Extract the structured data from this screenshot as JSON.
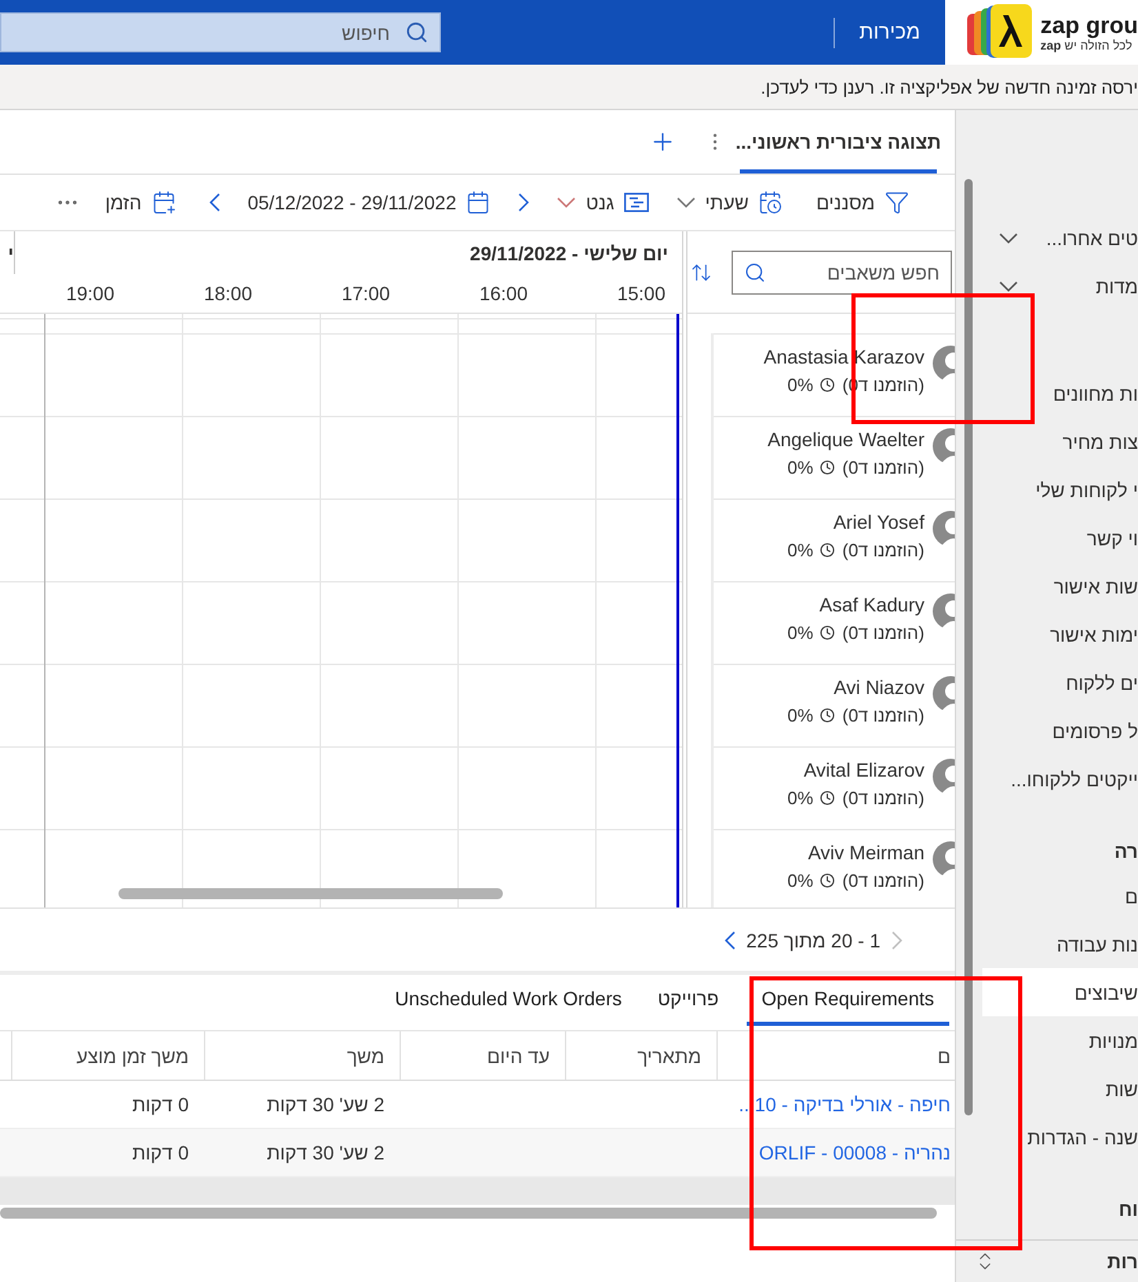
{
  "top_bar": {
    "logo_text": "zap grou",
    "logo_tagline": "לכל הזולה יש **zap**",
    "app_name": "מכירות",
    "search": {
      "placeholder": "חיפוש"
    }
  },
  "notification": "ירסה זמינה חדשה של אפליקציה זו. רענן כדי לעדכן.",
  "sidebar": {
    "items": [
      {
        "kind": "expander",
        "label": "טים אחרו...",
        "selected": false
      },
      {
        "kind": "expander",
        "label": "מדות",
        "selected": false
      },
      {
        "kind": "item",
        "label": "ות מחוונים",
        "selected": false
      },
      {
        "kind": "item",
        "label": "צות מחיר",
        "selected": false
      },
      {
        "kind": "item",
        "label": "י לקוחות שלי",
        "selected": false
      },
      {
        "kind": "item",
        "label": "וי קשר",
        "selected": false
      },
      {
        "kind": "item",
        "label": "שות אישור",
        "selected": false
      },
      {
        "kind": "item",
        "label": "ימות אישור",
        "selected": false
      },
      {
        "kind": "item",
        "label": "ים ללקוח",
        "selected": false
      },
      {
        "kind": "item",
        "label": "ל פרסומים",
        "selected": false
      },
      {
        "kind": "item",
        "label": "ייקטים ללקוחו...",
        "selected": false
      },
      {
        "kind": "group",
        "label": "רה",
        "selected": false
      },
      {
        "kind": "item",
        "label": "ם",
        "selected": false
      },
      {
        "kind": "item",
        "label": "נות עבודה",
        "selected": false
      },
      {
        "kind": "item",
        "label": "שיבוצים",
        "selected": true
      },
      {
        "kind": "item",
        "label": "מנויות",
        "selected": false
      },
      {
        "kind": "item",
        "label": "שות",
        "selected": false
      },
      {
        "kind": "item",
        "label": "שנה - הגדרות",
        "selected": false
      },
      {
        "kind": "group",
        "label": "וח",
        "selected": false
      }
    ],
    "area_switcher": {
      "label": "רות"
    }
  },
  "view_tabs": [
    {
      "label": "תצוגה ציבורית ראשוני...",
      "selected": true
    }
  ],
  "toolbar": {
    "filters": "מסננים",
    "resolution": "שעתי",
    "view": "גנט",
    "date_range": "29/11/2022 - 05/12/2022",
    "book": "הזמן"
  },
  "scheduler": {
    "resource_search": {
      "placeholder": "חפש משאבים"
    },
    "day_label": "יום שלישי - 29/11/2022",
    "next_day_label": "י",
    "hours": [
      "15:00",
      "16:00",
      "17:00",
      "18:00",
      "19:00"
    ],
    "resources": [
      {
        "name": "Anastasia Karazov",
        "booked": "(הוזמנו ד0)",
        "utilization": "0%"
      },
      {
        "name": "Angelique Waelter",
        "booked": "(הוזמנו ד0)",
        "utilization": "0%"
      },
      {
        "name": "Ariel Yosef",
        "booked": "(הוזמנו ד0)",
        "utilization": "0%"
      },
      {
        "name": "Asaf Kadury",
        "booked": "(הוזמנו ד0)",
        "utilization": "0%"
      },
      {
        "name": "Avi Niazov",
        "booked": "(הוזמנו ד0)",
        "utilization": "0%"
      },
      {
        "name": "Avital Elizarov",
        "booked": "(הוזמנו ד0)",
        "utilization": "0%"
      },
      {
        "name": "Aviv Meirman",
        "booked": "(הוזמנו ד0)",
        "utilization": "0%"
      }
    ]
  },
  "pagination": {
    "range": "1 - 20 מתוך 225",
    "previous_disabled": true,
    "next_disabled": false
  },
  "bottom_tabs": [
    {
      "label": "Open Requirements",
      "selected": true
    },
    {
      "label": "פרוייקט",
      "selected": false
    },
    {
      "label": "Unscheduled Work Orders",
      "selected": false
    }
  ],
  "requirements_table": {
    "columns": [
      "ם",
      "מתאריך",
      "עד היום",
      "משך",
      "משך זמן מוצע"
    ],
    "rows": [
      {
        "name": "חיפה - אורלי בדיקה - 10...",
        "duration": "2 שע' 30 דקות",
        "proposed_duration": "0 דקות"
      },
      {
        "name": "נהריה - ORLIF - 00008",
        "duration": "2 שע' 30 דקות",
        "proposed_duration": "0 דקות"
      }
    ]
  }
}
